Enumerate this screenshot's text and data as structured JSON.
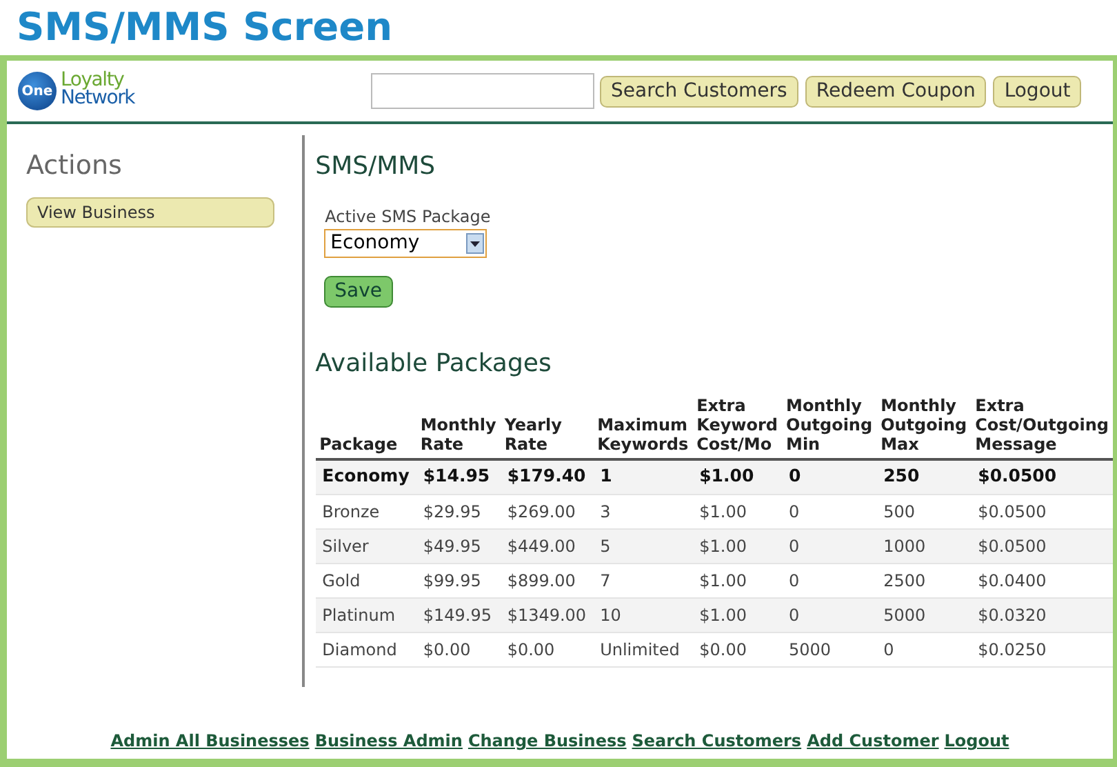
{
  "page_title": "SMS/MMS Screen",
  "logo": {
    "badge": "One",
    "line1": "Loyalty",
    "line2": "Network"
  },
  "header": {
    "buttons": [
      "Search Customers",
      "Redeem Coupon",
      "Logout"
    ]
  },
  "sidebar": {
    "title": "Actions",
    "items": [
      "View Business"
    ]
  },
  "main": {
    "title": "SMS/MMS",
    "package_field": {
      "label": "Active SMS Package",
      "value": "Economy"
    },
    "save_button": "Save",
    "packages_title": "Available Packages",
    "table": {
      "columns": [
        "Package",
        "Monthly Rate",
        "Yearly Rate",
        "Maximum Keywords",
        "Extra Keyword Cost/Mo",
        "Monthly Outgoing Min",
        "Monthly Outgoing Max",
        "Extra Cost/Outgoing Message"
      ],
      "rows": [
        {
          "selected": true,
          "cells": [
            "Economy",
            "$14.95",
            "$179.40",
            "1",
            "$1.00",
            "0",
            "250",
            "$0.0500"
          ]
        },
        {
          "selected": false,
          "cells": [
            "Bronze",
            "$29.95",
            "$269.00",
            "3",
            "$1.00",
            "0",
            "500",
            "$0.0500"
          ]
        },
        {
          "selected": false,
          "cells": [
            "Silver",
            "$49.95",
            "$449.00",
            "5",
            "$1.00",
            "0",
            "1000",
            "$0.0500"
          ]
        },
        {
          "selected": false,
          "cells": [
            "Gold",
            "$99.95",
            "$899.00",
            "7",
            "$1.00",
            "0",
            "2500",
            "$0.0400"
          ]
        },
        {
          "selected": false,
          "cells": [
            "Platinum",
            "$149.95",
            "$1349.00",
            "10",
            "$1.00",
            "0",
            "5000",
            "$0.0320"
          ]
        },
        {
          "selected": false,
          "cells": [
            "Diamond",
            "$0.00",
            "$0.00",
            "Unlimited",
            "$0.00",
            "5000",
            "0",
            "$0.0250"
          ]
        }
      ]
    }
  },
  "footer_links": [
    "Admin All Businesses",
    "Business Admin",
    "Change Business",
    "Search Customers",
    "Add Customer",
    "Logout"
  ]
}
